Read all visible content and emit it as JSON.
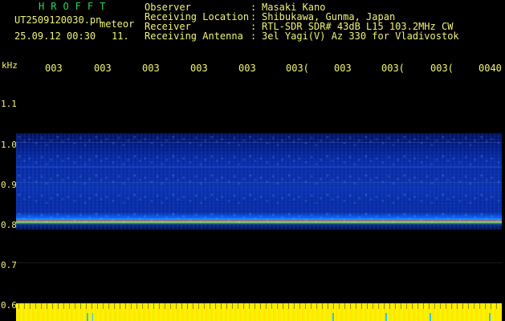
{
  "header": {
    "brand": "HROFFT",
    "filename": "UT2509120030.pn",
    "meteor": "meteor",
    "datetime": "25.09.12 00:30",
    "count": "11."
  },
  "meta": {
    "rows": [
      {
        "label": "Observer",
        "sep": ":",
        "value": "Masaki Kano"
      },
      {
        "label": "Receiving Location",
        "sep": ":",
        "value": "Shibukawa, Gunma, Japan"
      },
      {
        "label": "Receiver",
        "sep": ":",
        "value": "RTL-SDR SDR# 43dB L15 103.2MHz CW"
      },
      {
        "label": "Receiving Antenna",
        "sep": ":",
        "value": "3el Yagi(V) Az 330 for Vladivostok"
      }
    ]
  },
  "axis": {
    "unit": "kHz",
    "ticks": [
      "1.1",
      "1.0",
      "0.9",
      "0.8",
      "0.7",
      "0.6"
    ]
  },
  "timeline": {
    "labels": [
      "003",
      "003",
      "003",
      "003",
      "003",
      "003(",
      "003",
      "003(",
      "003(",
      "0040"
    ]
  }
}
